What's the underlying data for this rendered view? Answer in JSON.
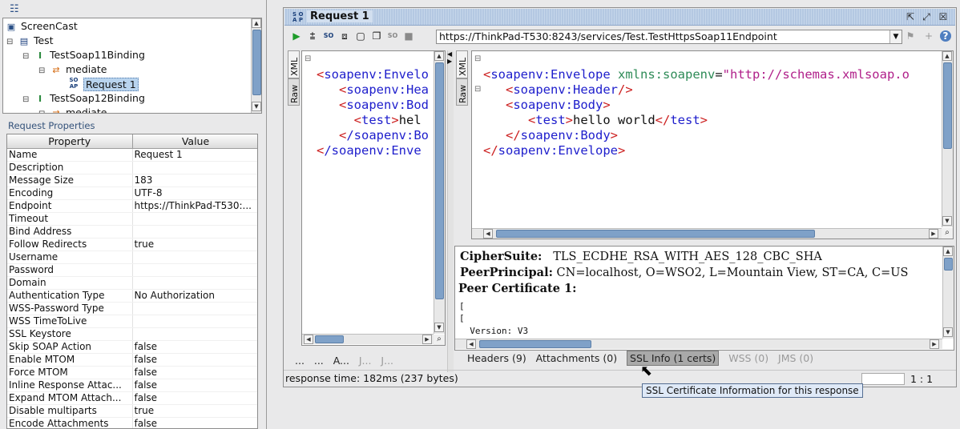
{
  "tree": {
    "items": [
      {
        "label": "ScreenCast",
        "icon": "workspace-icon",
        "twisty": ""
      },
      {
        "label": "Test",
        "icon": "project-icon",
        "twisty": "⊟"
      },
      {
        "label": "TestSoap11Binding",
        "icon": "interface-icon",
        "twisty": "⊟"
      },
      {
        "label": "mediate",
        "icon": "operation-icon",
        "twisty": "⊟"
      },
      {
        "label": "Request 1",
        "icon": "request-icon",
        "twisty": ""
      },
      {
        "label": "TestSoap12Binding",
        "icon": "interface-icon",
        "twisty": "⊟"
      },
      {
        "label": "mediate",
        "icon": "operation-icon",
        "twisty": "⊟"
      }
    ]
  },
  "properties": {
    "title": "Request Properties",
    "columns": [
      "Property",
      "Value"
    ],
    "rows": [
      [
        "Name",
        "Request 1"
      ],
      [
        "Description",
        ""
      ],
      [
        "Message Size",
        "183"
      ],
      [
        "Encoding",
        "UTF-8"
      ],
      [
        "Endpoint",
        "https://ThinkPad-T530:..."
      ],
      [
        "Timeout",
        ""
      ],
      [
        "Bind Address",
        ""
      ],
      [
        "Follow Redirects",
        "true"
      ],
      [
        "Username",
        ""
      ],
      [
        "Password",
        ""
      ],
      [
        "Domain",
        ""
      ],
      [
        "Authentication Type",
        "No Authorization"
      ],
      [
        "WSS-Password Type",
        ""
      ],
      [
        "WSS TimeToLive",
        ""
      ],
      [
        "SSL Keystore",
        ""
      ],
      [
        "Skip SOAP Action",
        "false"
      ],
      [
        "Enable MTOM",
        "false"
      ],
      [
        "Force MTOM",
        "false"
      ],
      [
        "Inline Response Attac...",
        "false"
      ],
      [
        "Expand MTOM Attach...",
        "false"
      ],
      [
        "Disable multiparts",
        "true"
      ],
      [
        "Encode Attachments",
        "false"
      ]
    ]
  },
  "window": {
    "title": "Request 1",
    "endpoint_url": "https://ThinkPad-T530:8243/services/Test.TestHttpsSoap11Endpoint"
  },
  "request_editor": {
    "tabs": [
      "XML",
      "Raw"
    ],
    "bottom_tabs": [
      "...",
      "...",
      "A...",
      "J...",
      "J..."
    ]
  },
  "response_editor": {
    "tabs": [
      "XML",
      "Raw"
    ],
    "lines": {
      "l1_open": "<",
      "l1_tag": "soapenv:Envelope",
      "l1_attr": "xmlns:soapenv",
      "l1_eq": "=",
      "l1_val": "\"http://schemas.xmlsoap.o",
      "l2_lt": "<",
      "l2_tag": "soapenv:Header",
      "l2_gt": "/>",
      "l3_lt": "<",
      "l3_tag": "soapenv:Body",
      "l3_gt": ">",
      "l4_lt": "<",
      "l4_tag": "test",
      "l4_gt": ">",
      "l4_text": "hello world",
      "l4_lt2": "</",
      "l4_tag2": "test",
      "l4_gt2": ">",
      "l5_lt": "</",
      "l5_tag": "soapenv:Body",
      "l5_gt": ">",
      "l6_lt": "</",
      "l6_tag": "soapenv:Envelope",
      "l6_gt": ">"
    },
    "request_lines": {
      "l1": "soapenv:Envelo",
      "l2": "soapenv:Hea",
      "l3": "soapenv:Bod",
      "l4": "test",
      "l4b": "hel",
      "l5": "/soapenv:Bo",
      "l6": "/soapenv:Enve"
    }
  },
  "ssl_info": {
    "cipher_label": "CipherSuite:",
    "cipher_value": "TLS_ECDHE_RSA_WITH_AES_128_CBC_SHA",
    "peer_label": "PeerPrincipal:",
    "peer_value": "CN=localhost, O=WSO2, L=Mountain View, ST=CA, C=US",
    "cert_label": "Peer Certificate 1:",
    "bracket1": "[",
    "bracket2": "[",
    "version_line": "  Version: V3"
  },
  "response_tabs": {
    "headers": "Headers (9)",
    "attachments": "Attachments (0)",
    "ssl": "SSL Info (1 certs)",
    "wss": "WSS (0)",
    "jms": "JMS (0)"
  },
  "status": {
    "response_time": "response time: 182ms (237 bytes)",
    "position": "1 : 1"
  },
  "tooltip": "SSL Certificate Information for this response"
}
